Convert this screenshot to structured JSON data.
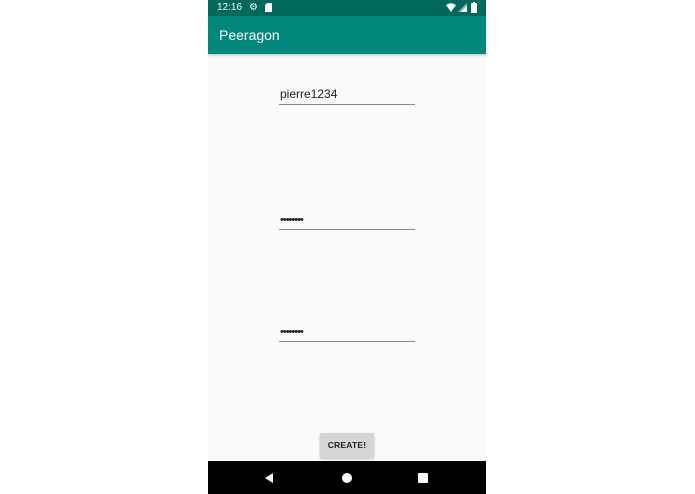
{
  "status_bar": {
    "time": "12:16",
    "icons": [
      "gear-icon",
      "sd-card-icon",
      "wifi-icon",
      "cell-signal-icon",
      "battery-icon"
    ]
  },
  "app_bar": {
    "title": "Peeragon"
  },
  "form": {
    "username_value": "pierre1234",
    "password_value": "••••••••",
    "confirm_password_value": "••••••••",
    "create_label": "CREATE!"
  },
  "nav_bar": {
    "icons": [
      "back-icon",
      "home-icon",
      "recents-icon"
    ]
  },
  "colors": {
    "status_bar": "#00695c",
    "app_bar": "#00897b",
    "background": "#fafafa",
    "button": "#d6d6d6",
    "nav_bar": "#000000"
  }
}
